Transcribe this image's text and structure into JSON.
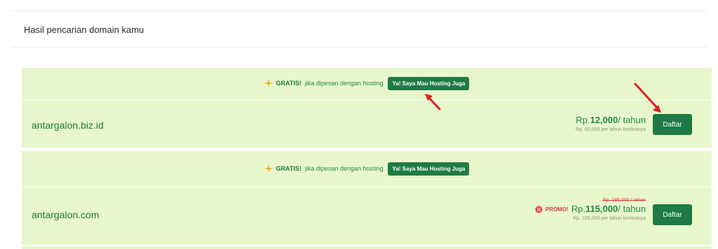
{
  "results": {
    "title": "Hasil pencarian domain kamu"
  },
  "promo_bar": {
    "free_label": "GRATIS!",
    "free_text": "jika dipesan dengan hosting",
    "hosting_button": "Ya! Saya Mau Hosting Juga"
  },
  "domains": [
    {
      "name": "antargalon.biz.id",
      "price_prefix": "Rp.",
      "price_value": "12,000",
      "price_suffix": "/ tahun",
      "renewal": "Rp. 60,000 per tahun berikutnya",
      "register_label": "Daftar"
    },
    {
      "name": "antargalon.com",
      "original_price": "Rp. 185,000 / tahun",
      "promo_label": "PROMO!",
      "price_prefix": "Rp.",
      "price_value": "115,000",
      "price_suffix": "/ tahun",
      "renewal": "Rp. 185,000 per tahun berikutnya",
      "register_label": "Daftar"
    }
  ],
  "colors": {
    "card_bg": "#e8f6cc",
    "accent_green": "#1f7a45",
    "promo_red": "#d83a4a",
    "arrow_red": "#e01f1f"
  },
  "icons": [
    "sparkle-icon",
    "promo-badge-icon",
    "annotation-arrow"
  ]
}
